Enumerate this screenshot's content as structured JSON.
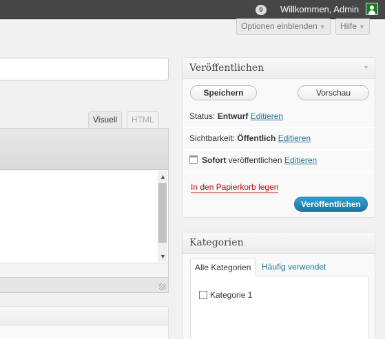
{
  "adminbar": {
    "comments_count": "0",
    "howdy": "Willkommen, Admin"
  },
  "screen_meta": {
    "options_label": "Optionen einblenden",
    "help_label": "Hilfe"
  },
  "editor": {
    "tab_visual": "Visuell",
    "tab_html": "HTML"
  },
  "publish": {
    "title": "Veröffentlichen",
    "save_label": "Speichern",
    "preview_label": "Vorschau",
    "status_label": "Status:",
    "status_value": "Entwurf",
    "edit_label": "Editieren",
    "visibility_label": "Sichtbarkeit:",
    "visibility_value": "Öffentlich",
    "schedule_value": "Sofort",
    "schedule_label": "veröffentlichen",
    "trash_label": "In den Papierkorb legen",
    "publish_label": "Veröffentlichen"
  },
  "categories": {
    "title": "Kategorien",
    "tab_all": "Alle Kategorien",
    "tab_popular": "Häufig verwendet",
    "items": [
      {
        "label": "Kategorie 1",
        "checked": false
      }
    ]
  }
}
